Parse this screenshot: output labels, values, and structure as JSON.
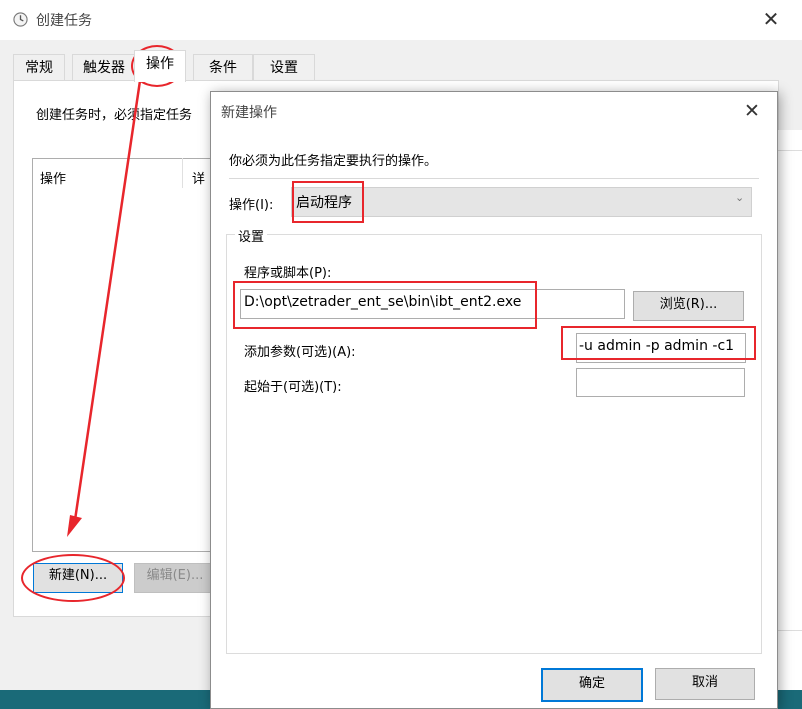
{
  "back_window": {
    "title": "创建任务",
    "close_glyph": "✕",
    "tabs": [
      {
        "label": "常规"
      },
      {
        "label": "触发器"
      },
      {
        "label": "操作"
      },
      {
        "label": "条件"
      },
      {
        "label": "设置"
      }
    ],
    "active_tab": "操作",
    "description": "创建任务时，必须指定任务",
    "columns": [
      "操作",
      "详"
    ],
    "new_button": "新建(N)...",
    "edit_button": "编辑(E)..."
  },
  "dialog": {
    "title": "新建操作",
    "close_glyph": "✕",
    "description": "你必须为此任务指定要执行的操作。",
    "action_label": "操作(I):",
    "action_value": "启动程序",
    "action_arrow": "⌄",
    "settings_label": "设置",
    "program_label": "程序或脚本(P):",
    "program_value": "D:\\opt\\zetrader_ent_se\\bin\\ibt_ent2.exe",
    "browse_button": "浏览(R)...",
    "args_label": "添加参数(可选)(A):",
    "args_value": "-u admin -p admin -c1",
    "start_label": "起始于(可选)(T):",
    "start_value": "",
    "ok_button": "确定",
    "cancel_button": "取消"
  },
  "colors": {
    "annotation": "#e8262c",
    "focus_blue": "#0078d7",
    "taskbar": "#1a6a78"
  },
  "icons": [
    "clock-icon",
    "close-icon",
    "chevron-down-icon"
  ]
}
